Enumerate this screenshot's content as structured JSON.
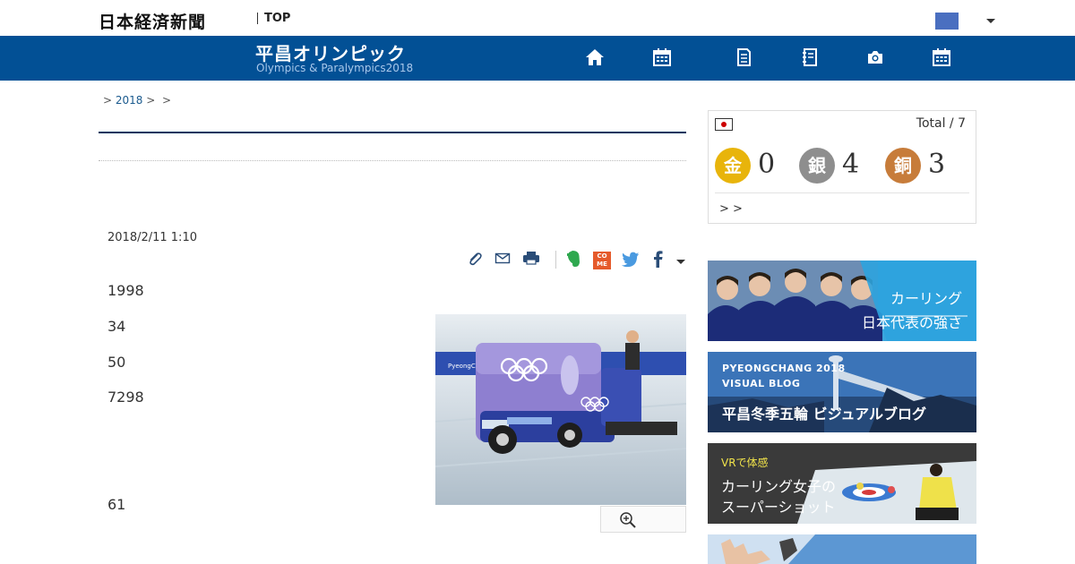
{
  "header": {
    "logo_text": "日本経済新聞",
    "top_link": "TOP"
  },
  "nav": {
    "title": "平昌オリンピック",
    "subtitle": "Olympics & Paralympics2018",
    "icons": [
      "home-icon",
      "calendar-icon",
      "document-icon",
      "notebook-icon",
      "camera-icon",
      "schedule-icon"
    ]
  },
  "breadcrumb": {
    "sep1": ">",
    "item1": "2018",
    "sep2": ">",
    "sep3": ">"
  },
  "article": {
    "date": "2018/2/11 1:10",
    "paragraphs": [
      "1998",
      "34",
      "50",
      "7298",
      "61"
    ]
  },
  "medals": {
    "total_label": "Total / 7",
    "gold_label": "金",
    "gold_count": "0",
    "silver_label": "銀",
    "silver_count": "4",
    "bronze_label": "銅",
    "bronze_count": "3",
    "more_link": "> >"
  },
  "banners": {
    "curling_line1": "カーリング",
    "curling_line2": "日本代表の強さ",
    "blog_line1": "PYEONGCHANG 2018",
    "blog_line2": "VISUAL BLOG",
    "blog_line3": "平昌冬季五輪 ビジュアルブログ",
    "vr_line1": "VRで体感",
    "vr_line2": "カーリング女子の",
    "vr_line3": "スーパーショット"
  },
  "share": {
    "come_label": "CO ME"
  },
  "photo": {
    "banner_text": "PyeongChang 2018"
  },
  "colors": {
    "nav_blue": "#025095",
    "gold": "#e8b40b",
    "silver": "#8e8e8e",
    "bronze": "#c77c3a"
  }
}
